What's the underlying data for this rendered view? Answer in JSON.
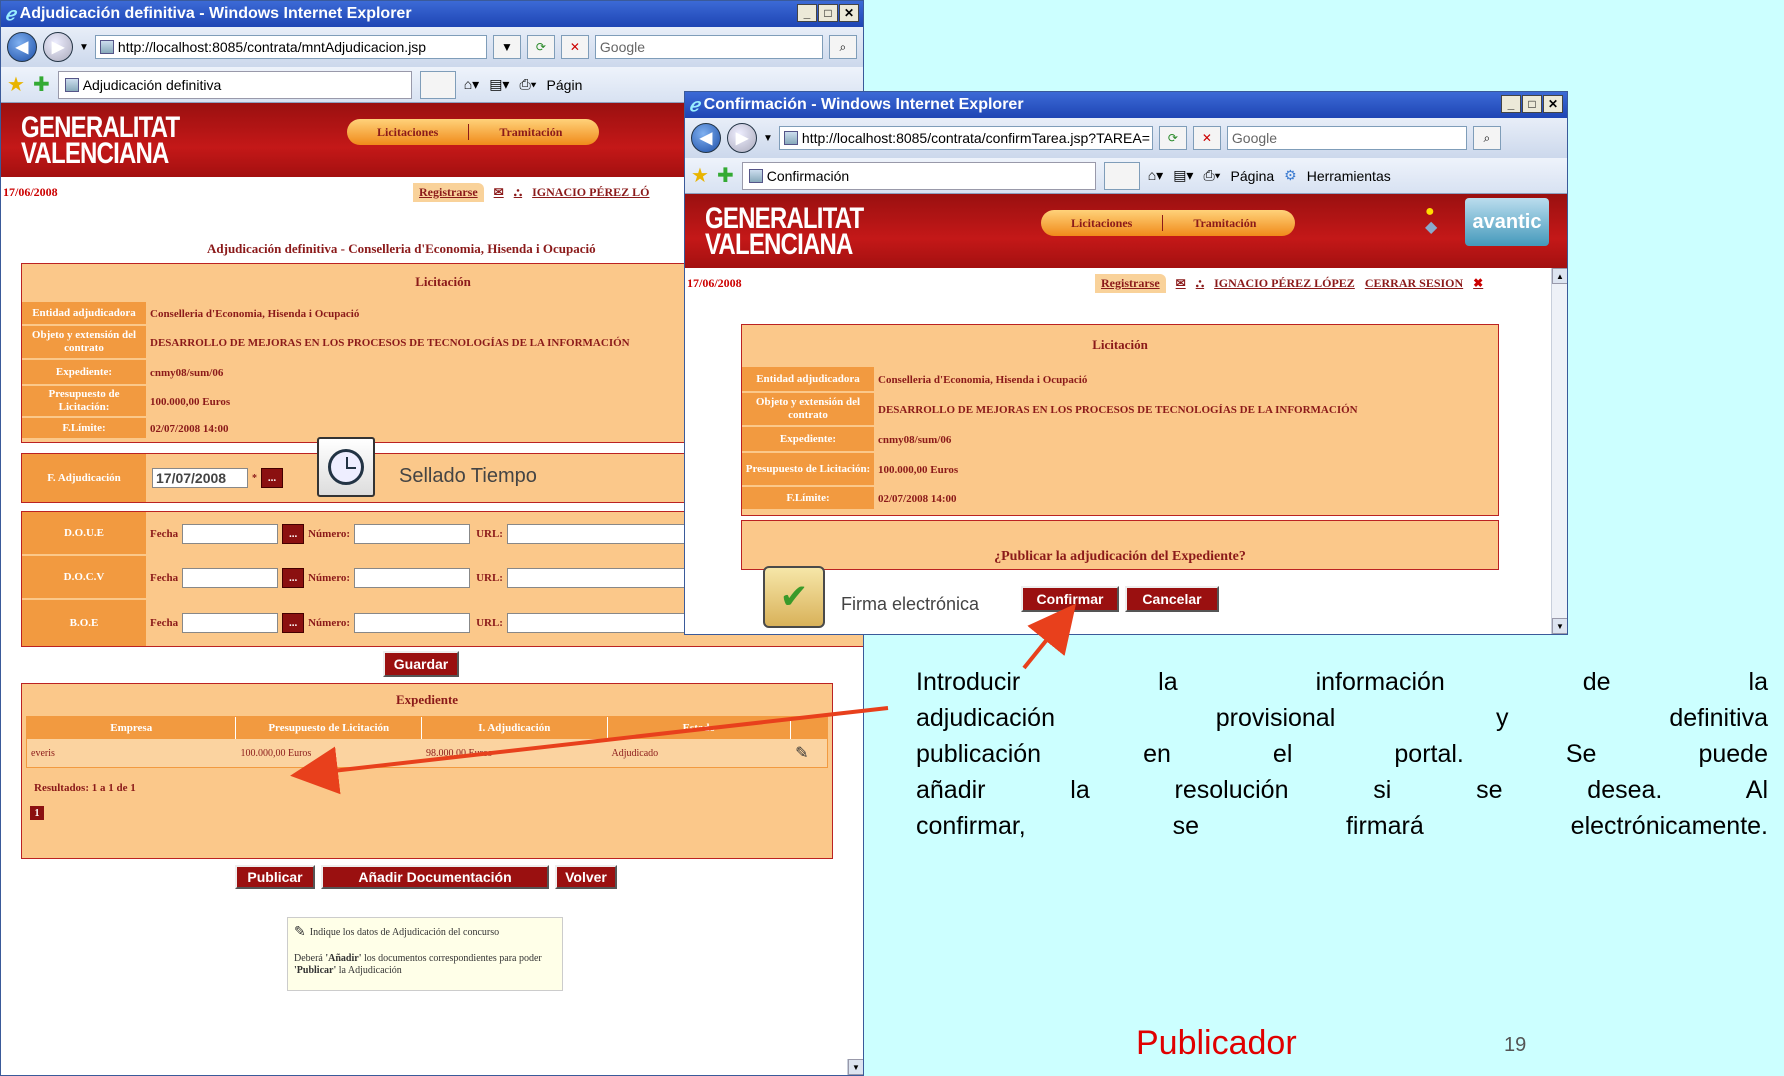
{
  "win1": {
    "title": "Adjudicación definitiva - Windows Internet Explorer",
    "url": "http://localhost:8085/contrata/mntAdjudicacion.jsp",
    "search_placeholder": "Google",
    "tab_label": "Adjudicación definitiva",
    "tools_pagina": "Págin",
    "tools_herramientas": "Herramientas",
    "logo_line1": "GENERALITAT",
    "logo_line2": "VALENCIANA",
    "nav": [
      "Licitaciones",
      "Tramitación"
    ],
    "date": "17/06/2008",
    "user_links": {
      "registrarse": "Registrarse",
      "user": "IGNACIO PÉREZ LÓ"
    },
    "page_title": "Adjudicación definitiva - Conselleria d'Economia, Hisenda i Ocupació",
    "licitacion": {
      "title": "Licitación",
      "rows": [
        {
          "label": "Entidad adjudicadora",
          "value": "Conselleria d'Economia, Hisenda i Ocupació"
        },
        {
          "label": "Objeto y extensión del contrato",
          "value": "DESARROLLO DE MEJORAS EN LOS PROCESOS DE TECNOLOGÍAS DE LA INFORMACIÓN"
        },
        {
          "label": "Expediente:",
          "value": "cnmy08/sum/06"
        },
        {
          "label": "Presupuesto de Licitación:",
          "value": "100.000,00 Euros"
        },
        {
          "label": "F.Límite:",
          "value": "02/07/2008 14:00"
        }
      ]
    },
    "f_adjudicacion": {
      "label": "F. Adjudicación",
      "value": "17/07/2008",
      "btn": "..."
    },
    "sellado_label": "Sellado Tiempo",
    "publicaciones": [
      {
        "label": "D.O.U.E",
        "fecha": "Fecha",
        "numero": "Número:",
        "url": "URL:"
      },
      {
        "label": "D.O.C.V",
        "fecha": "Fecha",
        "numero": "Número:",
        "url": "URL:"
      },
      {
        "label": "B.O.E",
        "fecha": "Fecha",
        "numero": "Número:",
        "url": "URL:"
      }
    ],
    "guardar": "Guardar",
    "expediente": {
      "title": "Expediente",
      "columns": [
        "Empresa",
        "Presupuesto de Licitación",
        "I. Adjudicación",
        "Estado"
      ],
      "row": [
        "everis",
        "100.000,00 Euros",
        "98.000,00 Euros",
        "Adjudicado"
      ],
      "results": "Resultados: 1 a 1 de 1",
      "page": "1"
    },
    "buttons": [
      "Publicar",
      "Añadir Documentación",
      "Volver"
    ],
    "help": {
      "line1": "Indique los datos de Adjudicación del concurso",
      "line2a": "Deberá ",
      "line2b": "'Añadir'",
      "line2c": " los documentos correspondientes para poder ",
      "line2d": "'Publicar'",
      "line2e": " la Adjudicación"
    }
  },
  "win2": {
    "title": "Confirmación - Windows Internet Explorer",
    "url": "http://localhost:8085/contrata/confirmTarea.jsp?TAREA=",
    "search_placeholder": "Google",
    "tab_label": "Confirmación",
    "tools_pagina": "Página",
    "tools_herramientas": "Herramientas",
    "logo_line1": "GENERALITAT",
    "logo_line2": "VALENCIANA",
    "nav": [
      "Licitaciones",
      "Tramitación"
    ],
    "avantic": "avantic",
    "date": "17/06/2008",
    "user_links": {
      "registrarse": "Registrarse",
      "user": "IGNACIO PÉREZ LÓPEZ",
      "cerrar": "CERRAR SESION"
    },
    "licitacion": {
      "title": "Licitación",
      "rows": [
        {
          "label": "Entidad adjudicadora",
          "value": "Conselleria d'Economia, Hisenda i Ocupació"
        },
        {
          "label": "Objeto y extensión del contrato",
          "value": "DESARROLLO DE MEJORAS EN LOS PROCESOS DE TECNOLOGÍAS DE LA INFORMACIÓN"
        },
        {
          "label": "Expediente:",
          "value": "cnmy08/sum/06"
        },
        {
          "label": "Presupuesto de Licitación:",
          "value": "100.000,00 Euros"
        },
        {
          "label": "F.Límite:",
          "value": "02/07/2008 14:00"
        }
      ]
    },
    "question": "¿Publicar la adjudicación del Expediente?",
    "firma_label": "Firma electrónica",
    "confirmar": "Confirmar",
    "cancelar": "Cancelar"
  },
  "caption": {
    "lines": [
      "Introducir la información de la",
      "adjudicación provisional y definitiva",
      "publicación en el portal. Se puede",
      "añadir la resolución si se desea. Al",
      "confirmar, se firmará electrónicamente."
    ],
    "role": "Publicador",
    "slide_number": "19"
  },
  "colors": {
    "arrow": "#e8401c",
    "role": "#e00000",
    "banner": "#b01414",
    "accent": "#f29a40"
  }
}
